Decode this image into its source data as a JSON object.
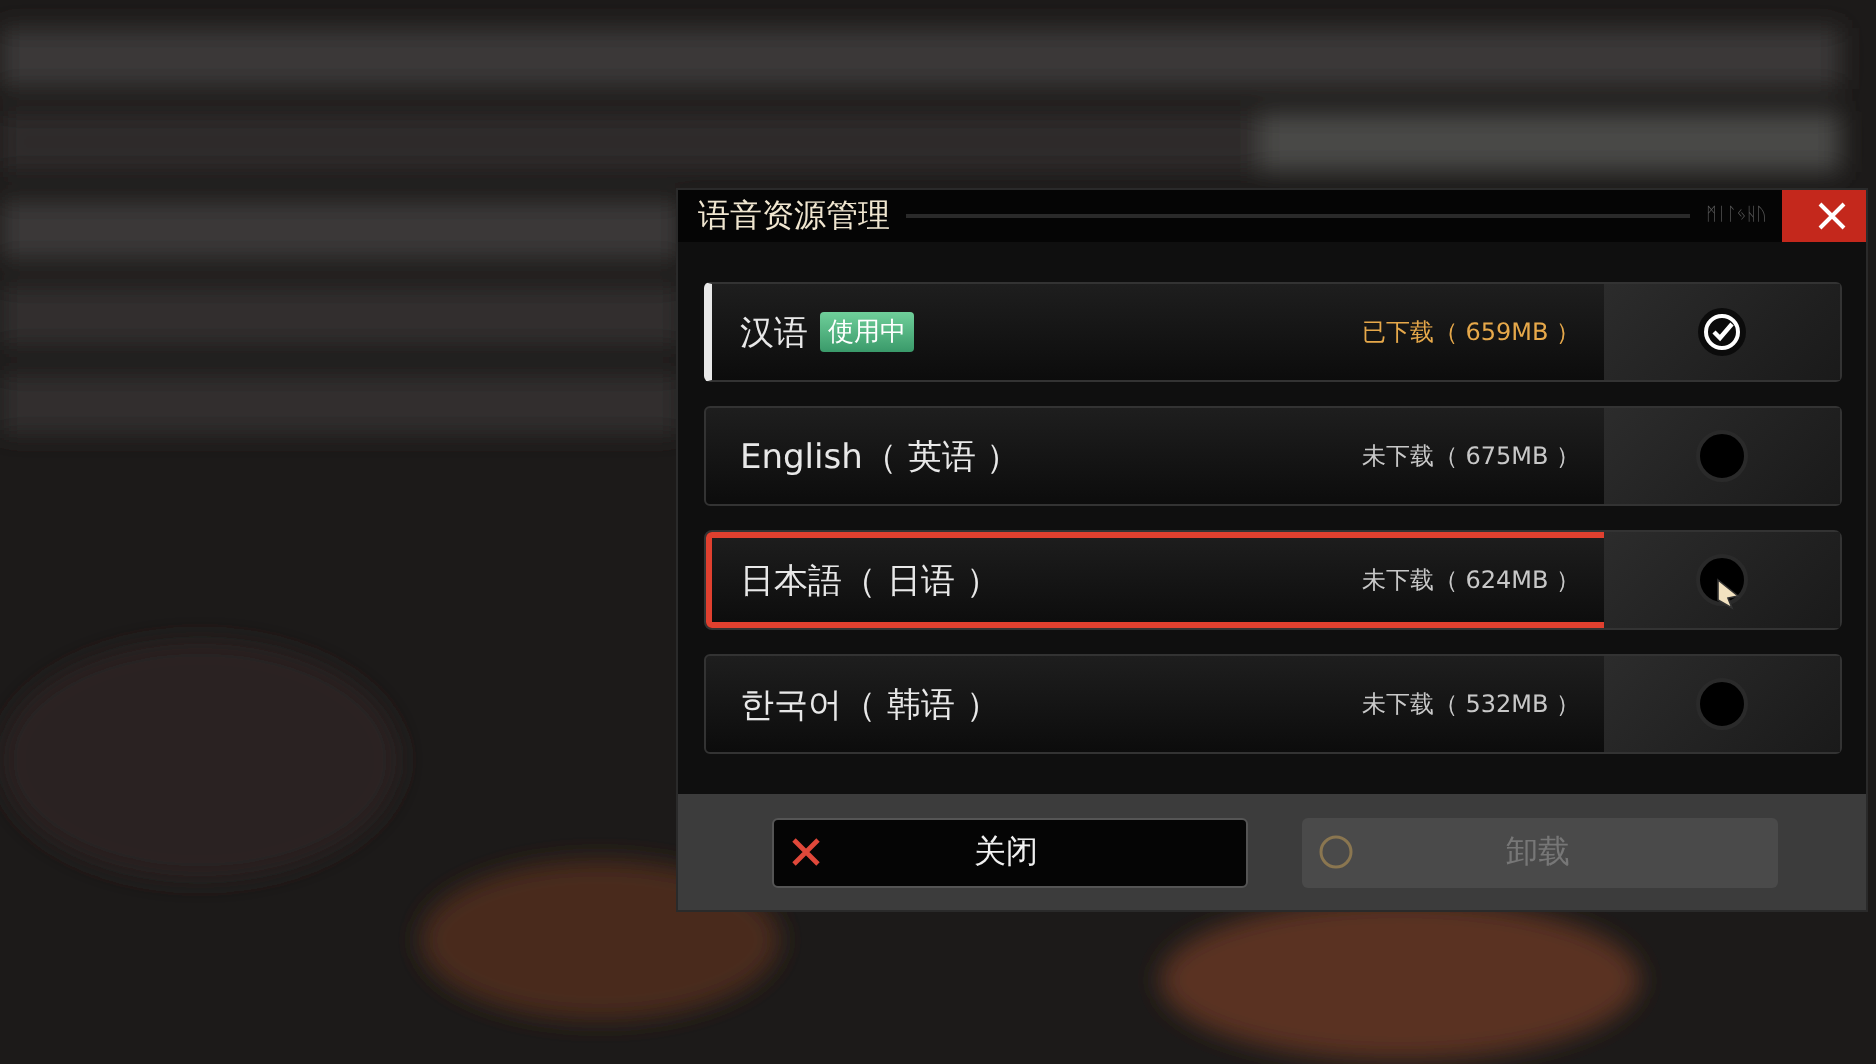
{
  "dialog": {
    "title": "语音资源管理",
    "title_decoration": "ᛗᛁᛚᛃᚺᚢ",
    "languages": [
      {
        "name": "汉语",
        "badge": "使用中",
        "status": "已下载（ 659MB ）",
        "downloaded": true,
        "selected": true,
        "highlighted": false
      },
      {
        "name": "English（ 英语 ）",
        "status": "未下载（ 675MB ）",
        "downloaded": false,
        "selected": false,
        "highlighted": false
      },
      {
        "name": "日本語（ 日语 ）",
        "status": "未下载（ 624MB ）",
        "downloaded": false,
        "selected": false,
        "highlighted": true
      },
      {
        "name": "한국어（ 韩语 ）",
        "status": "未下载（ 532MB ）",
        "downloaded": false,
        "selected": false,
        "highlighted": false
      }
    ],
    "buttons": [
      {
        "label": "关闭",
        "kind": "close",
        "disabled": false
      },
      {
        "label": "卸载",
        "kind": "uninstall",
        "disabled": true
      }
    ]
  }
}
